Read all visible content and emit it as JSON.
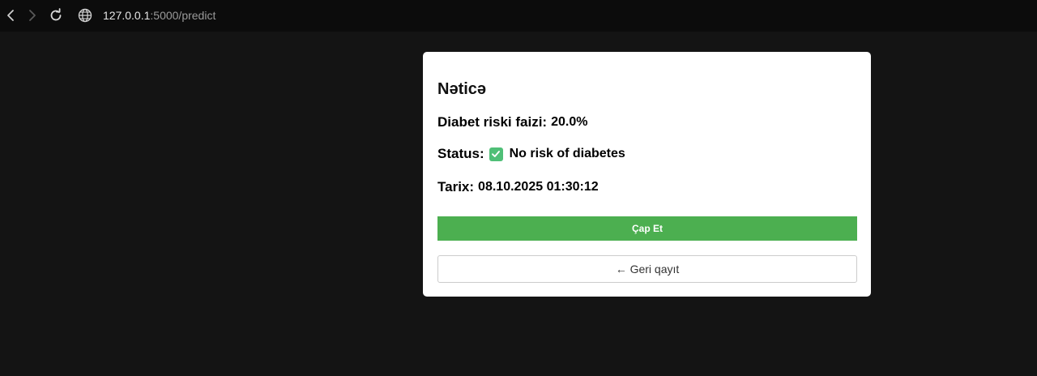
{
  "browser": {
    "url_host": "127.0.0.1",
    "url_path": ":5000/predict",
    "icons": [
      "back-icon",
      "forward-icon",
      "reload-icon",
      "globe-icon"
    ]
  },
  "result": {
    "title": "Nəticə",
    "risk_label": "Diabet riski faizi:",
    "risk_value": "20.0%",
    "status_label": "Status:",
    "status_icon": "check-mark-icon",
    "status_value": "No risk of diabetes",
    "date_label": "Tarix:",
    "date_value": "08.10.2025 01:30:12"
  },
  "actions": {
    "print_label": "Çap Et",
    "back_label": "← Geri qayıt"
  },
  "colors": {
    "page_background": "#141414",
    "toolbar_background": "#0c0c0c",
    "card_background": "#ffffff",
    "print_button": "#4caf50",
    "status_check": "#4fbf77"
  }
}
